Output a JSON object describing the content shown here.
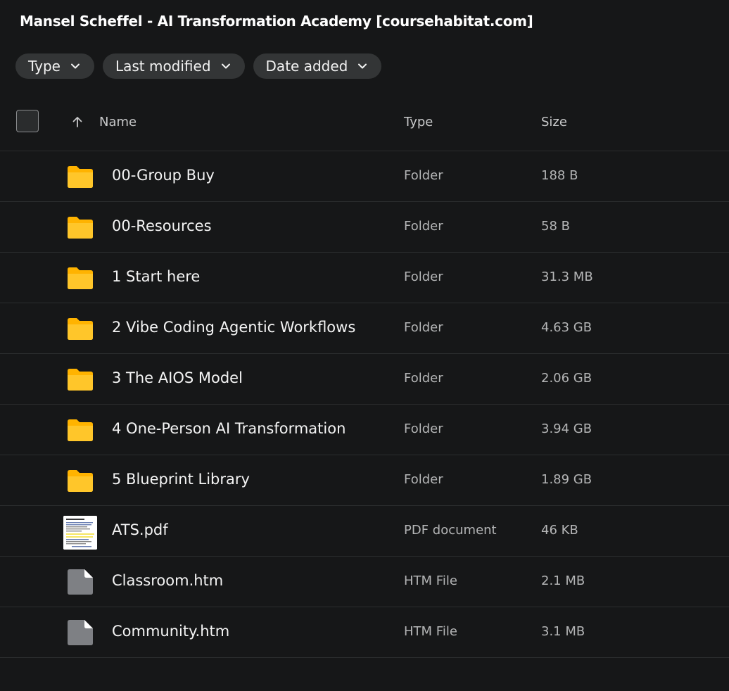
{
  "title": "Mansel Scheffel - AI Transformation Academy [coursehabitat.com]",
  "filters": [
    {
      "label": "Type",
      "icon": "chevron-down-icon"
    },
    {
      "label": "Last modified",
      "icon": "chevron-down-icon"
    },
    {
      "label": "Date added",
      "icon": "chevron-down-icon"
    }
  ],
  "columns": {
    "name": "Name",
    "type": "Type",
    "size": "Size",
    "sort_icon": "arrow-up-icon"
  },
  "colors": {
    "background": "#161718",
    "folder": "#FFB300",
    "file": "#7E8084"
  },
  "rows": [
    {
      "name": "00-Group Buy",
      "type": "Folder",
      "size": "188 B",
      "icon": "folder-icon"
    },
    {
      "name": "00-Resources",
      "type": "Folder",
      "size": "58 B",
      "icon": "folder-icon"
    },
    {
      "name": "1 Start here",
      "type": "Folder",
      "size": "31.3 MB",
      "icon": "folder-icon"
    },
    {
      "name": "2 Vibe Coding Agentic Workflows",
      "type": "Folder",
      "size": "4.63 GB",
      "icon": "folder-icon"
    },
    {
      "name": "3 The AIOS Model",
      "type": "Folder",
      "size": "2.06 GB",
      "icon": "folder-icon"
    },
    {
      "name": "4 One-Person AI Transformation",
      "type": "Folder",
      "size": "3.94 GB",
      "icon": "folder-icon"
    },
    {
      "name": "5 Blueprint Library",
      "type": "Folder",
      "size": "1.89 GB",
      "icon": "folder-icon"
    },
    {
      "name": "ATS.pdf",
      "type": "PDF document",
      "size": "46 KB",
      "icon": "pdf-thumbnail"
    },
    {
      "name": "Classroom.htm",
      "type": "HTM File",
      "size": "2.1 MB",
      "icon": "file-icon"
    },
    {
      "name": "Community.htm",
      "type": "HTM File",
      "size": "3.1 MB",
      "icon": "file-icon"
    }
  ]
}
